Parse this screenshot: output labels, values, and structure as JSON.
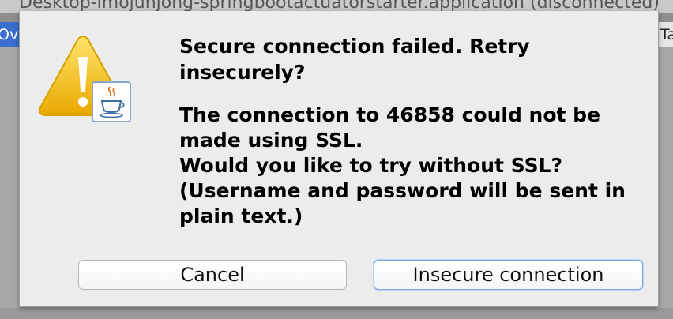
{
  "background": {
    "title_text": "Desktop-imojunjong-springbootactuatorstarter.application (disconnected)",
    "left_tab_text": "Ove",
    "right_tab_text": "Ta"
  },
  "dialog": {
    "title": "Secure connection failed. Retry insecurely?",
    "message": "The connection to 46858 could not be made using SSL.\nWould you like to try without SSL?\n(Username and password will be sent in plain text.)",
    "icon": "warning-java-icon",
    "buttons": {
      "cancel_label": "Cancel",
      "insecure_label": "Insecure connection"
    }
  },
  "colors": {
    "dialog_bg": "#ececec",
    "warning_yellow": "#f2c200",
    "default_button_border": "#7ea6e0",
    "background_tab_blue": "#3a6fcf"
  }
}
